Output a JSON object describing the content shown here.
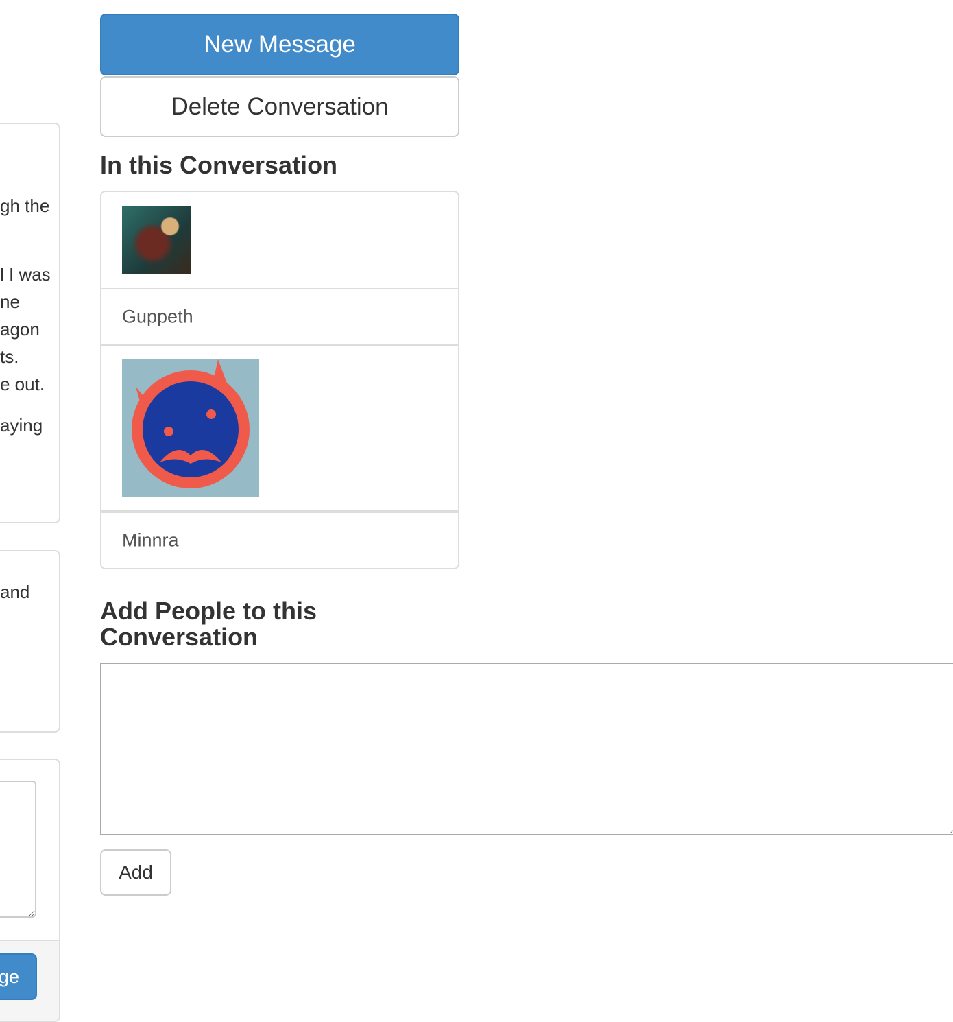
{
  "left_fragments": {
    "message1": [
      "gh the",
      "l I was",
      "ne",
      "agon",
      "ts.",
      "e out.",
      "aying"
    ],
    "message2": [
      "and"
    ],
    "send_button": "ge"
  },
  "sidebar": {
    "new_message": "New Message",
    "delete_conversation": "Delete Conversation",
    "participants_heading": "In this Conversation",
    "participants": [
      {
        "name": "Guppeth",
        "avatar": "warrior-avatar"
      },
      {
        "name": "Minnra",
        "avatar": "mustache-face-avatar"
      }
    ],
    "add_heading": "Add People to this Conversation",
    "add_input_value": "",
    "add_button": "Add"
  }
}
